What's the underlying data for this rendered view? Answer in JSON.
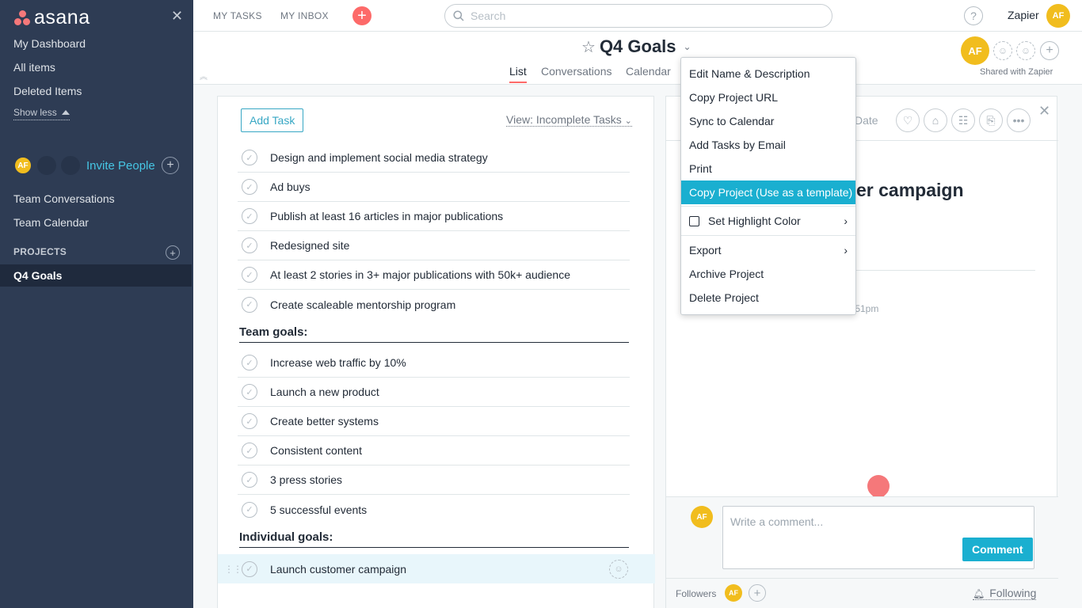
{
  "sidebar": {
    "logo": "asana",
    "close_glyph": "✕",
    "links": [
      "My Dashboard",
      "All items",
      "Deleted Items"
    ],
    "show_less": "Show less",
    "team_avatar": "AF",
    "invite": "Invite People",
    "team_links": [
      "Team Conversations",
      "Team Calendar"
    ],
    "projects_header": "PROJECTS",
    "active_project": "Q4 Goals"
  },
  "topbar": {
    "my_tasks": "MY TASKS",
    "my_inbox": "MY INBOX",
    "search_placeholder": "Search",
    "help": "?",
    "org": "Zapier",
    "user_avatar": "AF"
  },
  "project": {
    "title": "Q4 Goals",
    "tabs": [
      "List",
      "Conversations",
      "Calendar"
    ],
    "owner_avatar": "AF",
    "shared": "Shared with Zapier"
  },
  "list": {
    "add_task": "Add Task",
    "view": "View: Incomplete Tasks",
    "tasks": [
      "Design and implement social media strategy",
      "Ad buys",
      "Publish at least 16 articles in major publications",
      "Redesigned site",
      "At least 2 stories in 3+ major publications with 50k+ audience",
      "Create scaleable mentorship program"
    ],
    "team_section": "Team goals:",
    "team_tasks": [
      "Increase web traffic by 10%",
      "Launch a new product",
      "Create better systems",
      "Consistent content",
      "3 press stories",
      "5 successful events"
    ],
    "individual_section": "Individual goals:",
    "selected_task": "Launch customer campaign"
  },
  "detail": {
    "due_date": "Date",
    "title": "er campaign",
    "time": ":51pm",
    "comment_avatar": "AF",
    "comment_placeholder": "Write a comment...",
    "comment_button": "Comment",
    "followers_label": "Followers",
    "follower_avatar": "AF",
    "following": "Following"
  },
  "menu": {
    "items": [
      "Edit Name & Description",
      "Copy Project URL",
      "Sync to Calendar",
      "Add Tasks by Email",
      "Print",
      "Copy Project (Use as a template)",
      "Set Highlight Color",
      "Export",
      "Archive Project",
      "Delete Project"
    ],
    "highlight_color": "#1aafd0"
  },
  "colors": {
    "sidebar": "#2e3c54",
    "accent": "#fd6a69",
    "avatar": "#f1bd1e",
    "link": "#46c6e4"
  }
}
